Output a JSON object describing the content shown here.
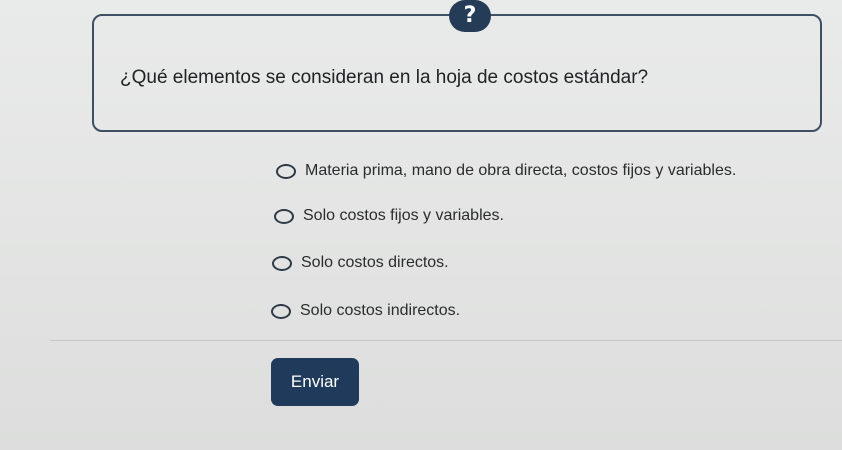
{
  "question": {
    "help_icon": "question-mark-icon",
    "help_glyph": "?",
    "text": "¿Qué elementos se consideran en la hoja de costos estándar?"
  },
  "options": [
    {
      "label": "Materia prima, mano de obra directa, costos fijos y variables.",
      "selected": false
    },
    {
      "label": "Solo costos fijos y variables.",
      "selected": false
    },
    {
      "label": "Solo costos directos.",
      "selected": false
    },
    {
      "label": "Solo costos indirectos.",
      "selected": false
    }
  ],
  "submit": {
    "label": "Enviar"
  },
  "colors": {
    "accent": "#1f3a5b",
    "border": "#3f4f63",
    "text": "#2a2c2e"
  }
}
